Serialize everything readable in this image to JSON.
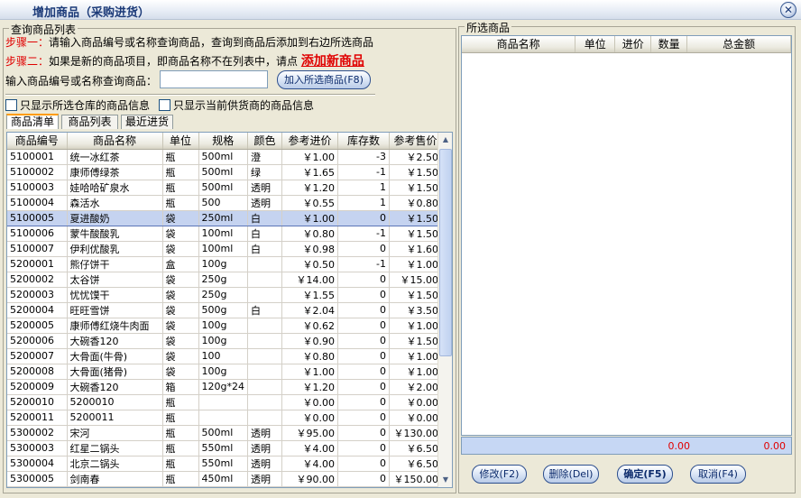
{
  "window": {
    "title": "增加商品（采购进货）",
    "close_glyph": "✕"
  },
  "query_panel": {
    "legend": "查询商品列表",
    "step1_label": "步骤一：",
    "step1_text": "请输入商品编号或名称查询商品，查询到商品后添加到右边所选商品",
    "step2_label": "步骤二：",
    "step2_text": "如果是新的商品项目，即商品名称不在列表中，请点",
    "add_new_link": "添加新商品",
    "search_label": "输入商品编号或名称查询商品：",
    "search_value": "",
    "add_selected_button": "加入所选商品(F8)",
    "checkbox_warehouse": "只显示所选仓库的商品信息",
    "checkbox_supplier": "只显示当前供货商的商品信息",
    "tabs": [
      "商品清单",
      "商品列表",
      "最近进货"
    ],
    "active_tab": 0
  },
  "product_table": {
    "columns": [
      "商品编号",
      "商品名称",
      "单位",
      "规格",
      "颜色",
      "参考进价",
      "库存数",
      "参考售价"
    ],
    "selected_row": 4,
    "rows": [
      [
        "5100001",
        "统一冰红茶",
        "瓶",
        "500ml",
        "澄",
        "￥1.00",
        "-3",
        "￥2.50"
      ],
      [
        "5100002",
        "康师傅绿茶",
        "瓶",
        "500ml",
        "绿",
        "￥1.65",
        "-1",
        "￥1.50"
      ],
      [
        "5100003",
        "娃哈哈矿泉水",
        "瓶",
        "500ml",
        "透明",
        "￥1.20",
        "1",
        "￥1.50"
      ],
      [
        "5100004",
        "森活水",
        "瓶",
        "500",
        "透明",
        "￥0.55",
        "1",
        "￥0.80"
      ],
      [
        "5100005",
        "夏进酸奶",
        "袋",
        "250ml",
        "白",
        "￥1.00",
        "0",
        "￥1.50"
      ],
      [
        "5100006",
        "蒙牛酸酸乳",
        "袋",
        "100ml",
        "白",
        "￥0.80",
        "-1",
        "￥1.50"
      ],
      [
        "5100007",
        "伊利优酸乳",
        "袋",
        "100ml",
        "白",
        "￥0.98",
        "0",
        "￥1.60"
      ],
      [
        "5200001",
        "熊仔饼干",
        "盒",
        "100g",
        "",
        "￥0.50",
        "-1",
        "￥1.00"
      ],
      [
        "5200002",
        "太谷饼",
        "袋",
        "250g",
        "",
        "￥14.00",
        "0",
        "￥15.00"
      ],
      [
        "5200003",
        "忧忧馍干",
        "袋",
        "250g",
        "",
        "￥1.55",
        "0",
        "￥1.50"
      ],
      [
        "5200004",
        "旺旺雪饼",
        "袋",
        "500g",
        "白",
        "￥2.04",
        "0",
        "￥3.50"
      ],
      [
        "5200005",
        "康师傅红烧牛肉面",
        "袋",
        "100g",
        "",
        "￥0.62",
        "0",
        "￥1.00"
      ],
      [
        "5200006",
        "大碗香120",
        "袋",
        "100g",
        "",
        "￥0.90",
        "0",
        "￥1.50"
      ],
      [
        "5200007",
        "大骨面(牛骨)",
        "袋",
        "100",
        "",
        "￥0.80",
        "0",
        "￥1.00"
      ],
      [
        "5200008",
        "大骨面(猪骨)",
        "袋",
        "100g",
        "",
        "￥1.00",
        "0",
        "￥1.00"
      ],
      [
        "5200009",
        "大碗香120",
        "箱",
        "120g*24",
        "",
        "￥1.20",
        "0",
        "￥2.00"
      ],
      [
        "5200010",
        "5200010",
        "瓶",
        "",
        "",
        "￥0.00",
        "0",
        "￥0.00"
      ],
      [
        "5200011",
        "5200011",
        "瓶",
        "",
        "",
        "￥0.00",
        "0",
        "￥0.00"
      ],
      [
        "5300002",
        "宋河",
        "瓶",
        "500ml",
        "透明",
        "￥95.00",
        "0",
        "￥130.00"
      ],
      [
        "5300003",
        "红星二锅头",
        "瓶",
        "550ml",
        "透明",
        "￥4.00",
        "0",
        "￥6.50"
      ],
      [
        "5300004",
        "北京二锅头",
        "瓶",
        "550ml",
        "透明",
        "￥4.00",
        "0",
        "￥6.50"
      ],
      [
        "5300005",
        "剑南春",
        "瓶",
        "450ml",
        "透明",
        "￥90.00",
        "0",
        "￥150.00"
      ]
    ]
  },
  "selected_panel": {
    "legend": "所选商品",
    "columns": [
      "商品名称",
      "单位",
      "进价",
      "数量",
      "总金额"
    ],
    "total_amount_1": "0.00",
    "total_amount_2": "0.00"
  },
  "buttons": {
    "edit": "修改(F2)",
    "delete": "删除(Del)",
    "confirm": "确定(F5)",
    "cancel": "取消(F4)"
  },
  "icons": {
    "scroll_up": "▲",
    "scroll_down": "▼"
  },
  "colors": {
    "step_red": "#e00000",
    "selected_row": "#c5d3f0",
    "total_bar": "#c6d7f4"
  }
}
